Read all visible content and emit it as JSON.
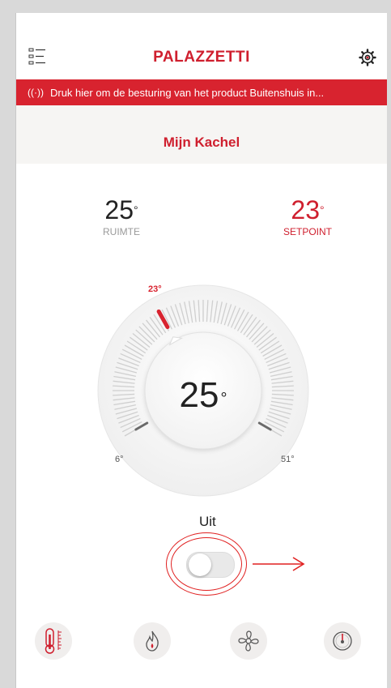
{
  "header": {
    "brand": "PALAZZETTI",
    "menu_icon": "menu-icon",
    "settings_icon": "gear-icon"
  },
  "banner": {
    "icon": "antenna-icon",
    "text": "Druk hier om de besturing van het product Buitenshuis in..."
  },
  "device": {
    "name": "Mijn Kachel"
  },
  "room": {
    "value": "25",
    "unit": "°",
    "label": "RUIMTE"
  },
  "setpoint": {
    "value": "23",
    "unit": "°",
    "label": "SETPOINT"
  },
  "dial": {
    "setpoint_marker": "23°",
    "center_value": "25",
    "center_unit": "°",
    "min_label": "6°",
    "max_label": "51°",
    "min": 6,
    "max": 51,
    "setpoint": 23
  },
  "power": {
    "label": "Uit",
    "state": "off"
  },
  "bottom_nav": [
    {
      "icon": "thermometer-icon"
    },
    {
      "icon": "flame-icon"
    },
    {
      "icon": "fan-icon"
    },
    {
      "icon": "gauge-icon"
    }
  ],
  "colors": {
    "accent": "#cf1f2e",
    "banner_bg": "#d8232f",
    "annotation": "#e02020"
  }
}
